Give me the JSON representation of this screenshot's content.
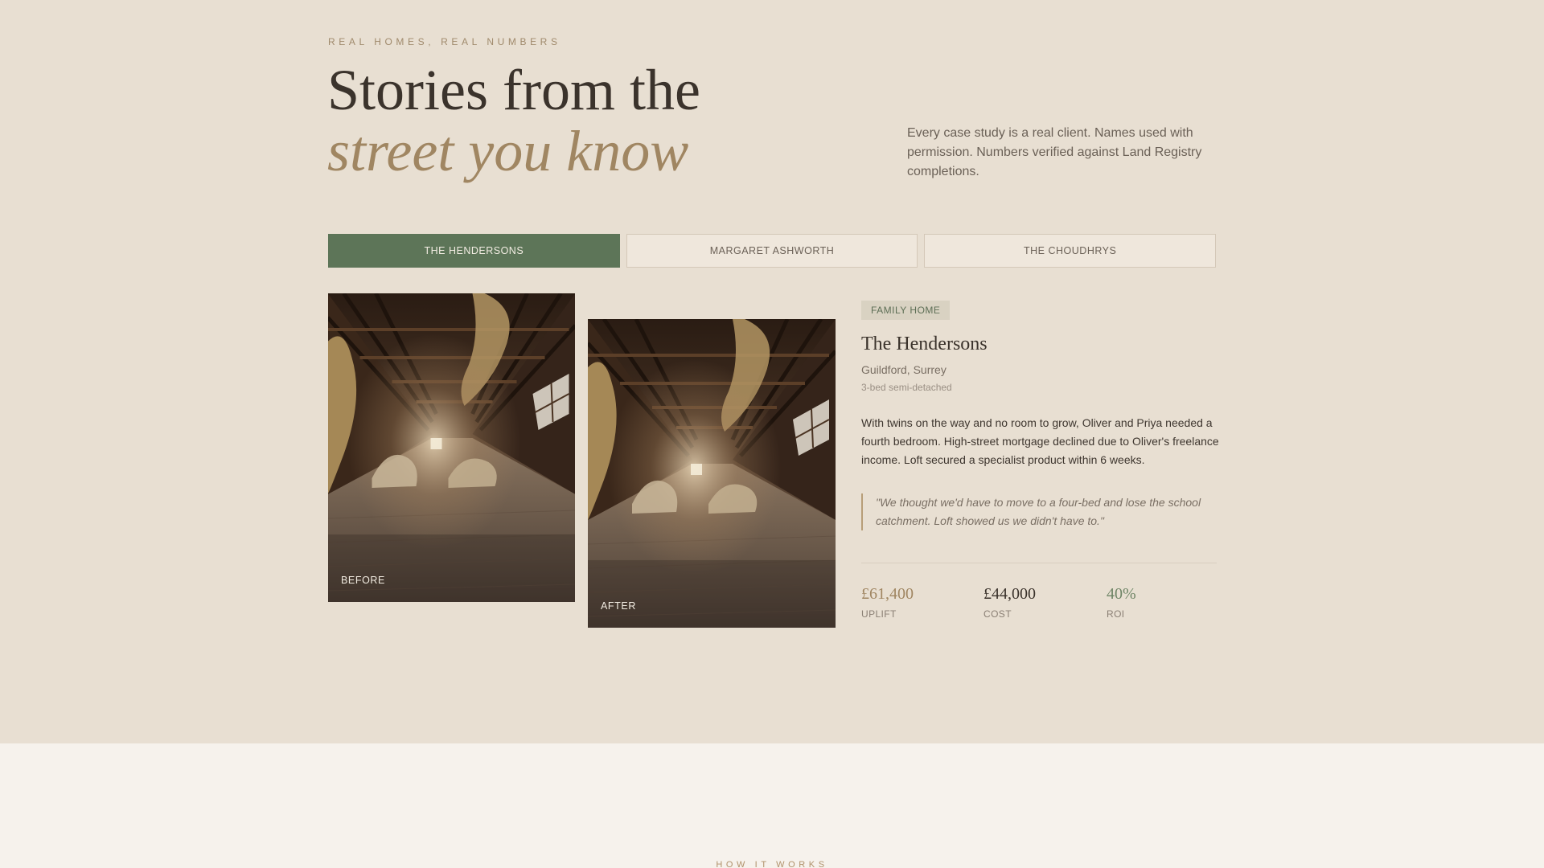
{
  "header": {
    "eyebrow": "REAL HOMES, REAL NUMBERS",
    "title_line1": "Stories from the",
    "title_line2": "street you know",
    "intro": "Every case study is a real client. Names used with permission. Numbers verified against Land Registry completions."
  },
  "tabs": [
    {
      "label": "THE HENDERSONS",
      "active": true
    },
    {
      "label": "MARGARET ASHWORTH",
      "active": false
    },
    {
      "label": "THE CHOUDHRYS",
      "active": false
    }
  ],
  "gallery": {
    "before_label": "BEFORE",
    "after_label": "AFTER"
  },
  "case": {
    "badge": "FAMILY HOME",
    "name": "The Hendersons",
    "location": "Guildford, Surrey",
    "property": "3-bed semi-detached",
    "story": "With twins on the way and no room to grow, Oliver and Priya needed a fourth bedroom. High-street mortgage declined due to Oliver's freelance income. Loft secured a specialist product within 6 weeks.",
    "quote": "\"We thought we'd have to move to a four-bed and lose the school catchment. Loft showed us we didn't have to.\"",
    "stats": [
      {
        "value": "£61,400",
        "label": "UPLIFT"
      },
      {
        "value": "£44,000",
        "label": "COST"
      },
      {
        "value": "40%",
        "label": "ROI"
      }
    ]
  },
  "next_section": {
    "eyebrow": "HOW IT WORKS"
  },
  "colors": {
    "background": "#e8dfd2",
    "accent_green": "#5d7558",
    "accent_gold": "#a08662",
    "lower_background": "#f6f2ec"
  }
}
